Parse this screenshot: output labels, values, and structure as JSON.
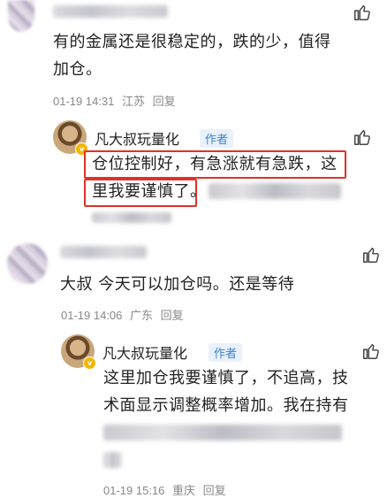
{
  "comments": [
    {
      "content": "有的金属还是很稳定的，跌的少，值得加仓。",
      "line1": "有的金属还是很稳定的，跌的少，值得",
      "line2": "加仓。",
      "time": "01-19 14:31",
      "location": "江苏",
      "reply_label": "回复",
      "reply": {
        "author": "凡大叔玩量化",
        "author_tag": "作者",
        "line1": "仓位控制好，有急涨就有急跌，这",
        "line2": "里我要谨慎了。"
      }
    },
    {
      "line1": "大叔 今天可以加仓吗。还是等待",
      "time": "01-19 14:06",
      "location": "广东",
      "reply_label": "回复",
      "reply": {
        "author": "凡大叔玩量化",
        "author_tag": "作者",
        "line1": "这里加仓我要谨慎了，不追高，技",
        "line2": "术面显示调整概率增加。我在持有",
        "time": "01-19 15:16",
        "location": "重庆",
        "reply_label": "回复"
      }
    }
  ],
  "icons": {
    "like": "thumbs-up-icon",
    "verified_badge": "verified-v-badge"
  },
  "colors": {
    "highlight_border": "#e0312b",
    "author_tag_text": "#3b82d6",
    "author_tag_bg": "#e9f1fc",
    "meta_text": "#888888"
  }
}
